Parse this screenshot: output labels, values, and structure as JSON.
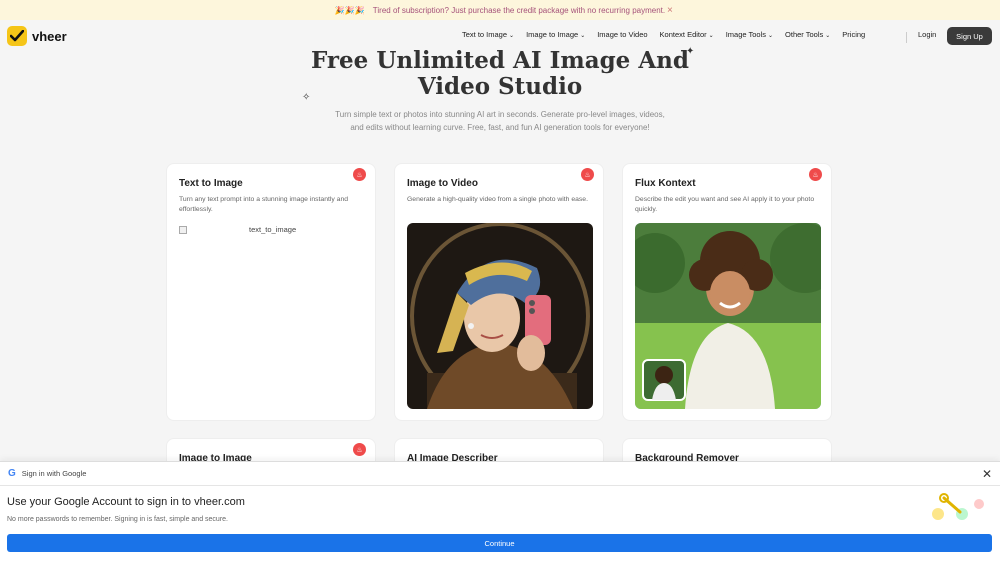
{
  "promo": {
    "emoji": "🎉🎉🎉",
    "text": "Tired of subscription? Just purchase the credit package with no recurring payment.",
    "close": "×"
  },
  "brand": {
    "name": "vheer",
    "color": "#f5c518"
  },
  "nav": {
    "items": [
      {
        "label": "Text to Image",
        "dropdown": true
      },
      {
        "label": "Image to Image",
        "dropdown": true
      },
      {
        "label": "Image to Video",
        "dropdown": false
      },
      {
        "label": "Kontext Editor",
        "dropdown": true
      },
      {
        "label": "Image Tools",
        "dropdown": true
      },
      {
        "label": "Other Tools",
        "dropdown": true
      },
      {
        "label": "Pricing",
        "dropdown": false
      }
    ],
    "login": "Login",
    "signup": "Sign Up"
  },
  "hero": {
    "title": "Free Unlimited AI Image And Video Studio",
    "subtitle": "Turn simple text or photos into stunning AI art in seconds. Generate pro-level images, videos, and edits without learning curve. Free, fast, and fun AI generation tools for everyone!"
  },
  "cards": [
    {
      "title": "Text to Image",
      "desc": "Turn any text prompt into a stunning image instantly and effortlessly.",
      "img_alt": "text_to_image"
    },
    {
      "title": "Image to Video",
      "desc": "Generate a high-quality video from a single photo with ease."
    },
    {
      "title": "Flux Kontext",
      "desc": "Describe the edit you want and see AI apply it to your photo quickly."
    },
    {
      "title": "Image to Image"
    },
    {
      "title": "AI Image Describer"
    },
    {
      "title": "Background Remover"
    }
  ],
  "google": {
    "header": "Sign in with Google",
    "title": "Use your Google Account to sign in to vheer.com",
    "desc": "No more passwords to remember. Signing in is fast, simple and secure.",
    "continue": "Continue",
    "accent": "#1a73e8"
  },
  "colors": {
    "hot_badge": "#ef4b4b",
    "signup_bg": "#3a3a3a"
  }
}
